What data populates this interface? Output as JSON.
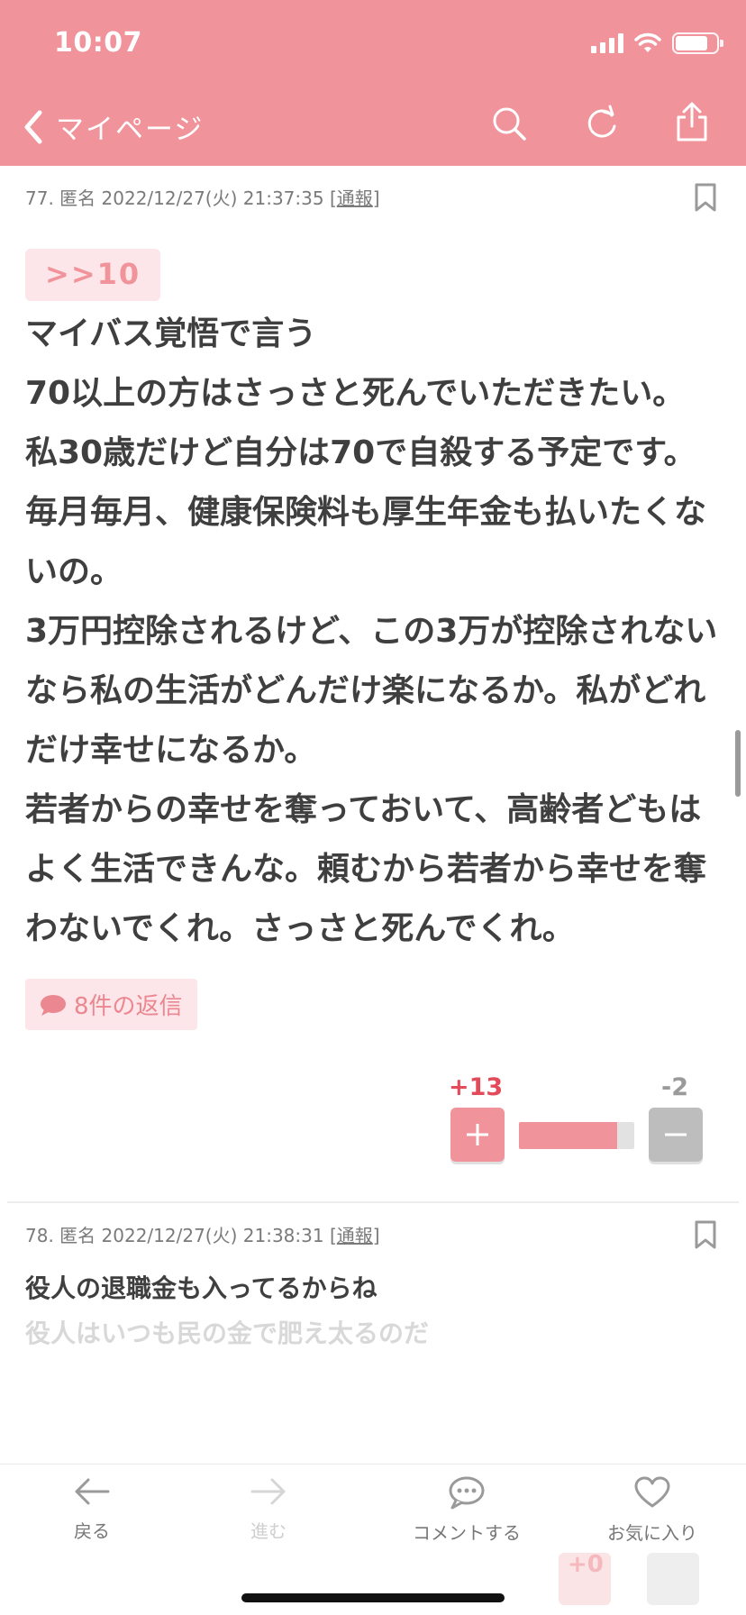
{
  "status_bar": {
    "time": "10:07",
    "battery_percent": 80
  },
  "nav": {
    "back_label": "マイページ",
    "icons": [
      "chevron-left-icon",
      "search-icon",
      "reload-icon",
      "share-icon"
    ]
  },
  "post77": {
    "number": "77.",
    "author": "匿名",
    "datetime": "2022/12/27(火) 21:37:35",
    "report_open": "[",
    "report_label": "通報",
    "report_close": "]",
    "anchor": ">>10",
    "body": "マイバス覚悟で言う\n70以上の方はさっさと死んでいただきたい。\n私30歳だけど自分は70で自殺する予定です。\n毎月毎月、健康保険料も厚生年金も払いたくないの。\n3万円控除されるけど、この3万が控除されないなら私の生活がどんだけ楽になるか。私がどれだけ幸せになるか。\n若者からの幸せを奪っておいて、高齢者どもはよく生活できんな。頼むから若者から幸せを奪わないでくれ。さっさと死んでくれ。",
    "replies_label": "8件の返信",
    "plus_count": "+13",
    "minus_count": "-2",
    "vote_ratio": 0.85
  },
  "post78": {
    "number": "78.",
    "author": "匿名",
    "datetime": "2022/12/27(火) 21:38:31",
    "report_open": "[",
    "report_label": "通報",
    "report_close": "]",
    "body_line1": "役人の退職金も入ってるからね",
    "body_line2": "役人はいつも民の金で肥え太るのだ",
    "plus_count": "+0"
  },
  "toolbar": {
    "back": "戻る",
    "forward": "進む",
    "comment": "コメントする",
    "favorite": "お気に入り"
  },
  "colors": {
    "header": "#f0939a",
    "accent": "#f0939a",
    "plus": "#e34b5a",
    "minus": "#bdbdbd"
  }
}
